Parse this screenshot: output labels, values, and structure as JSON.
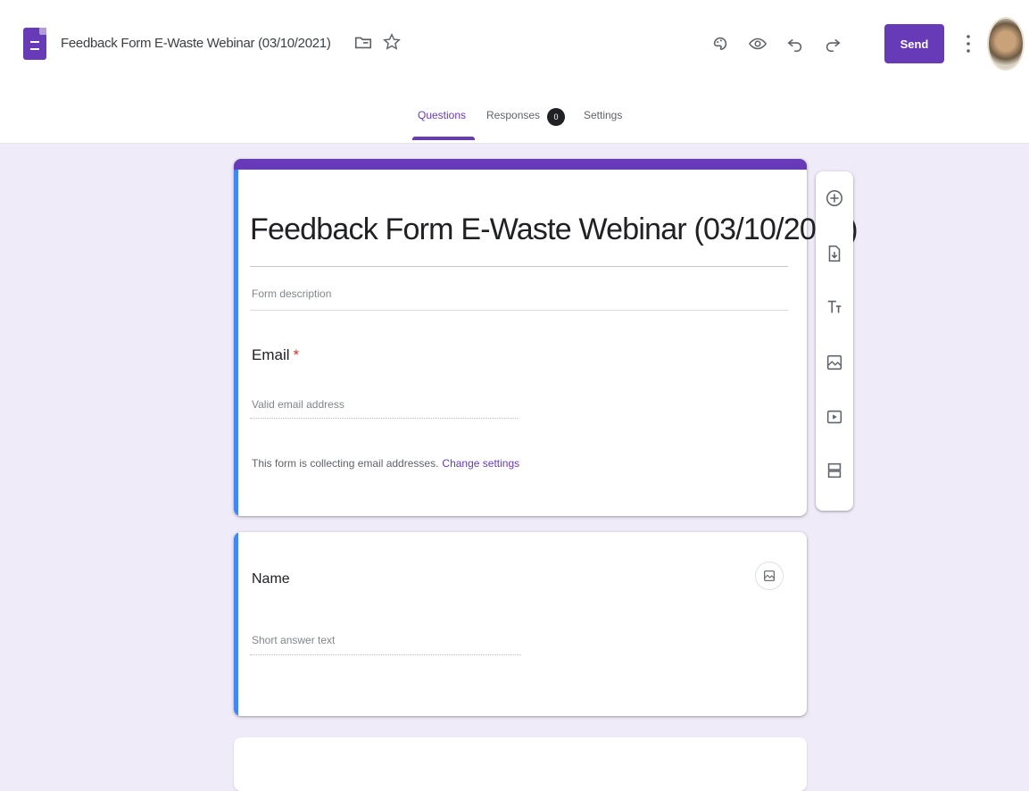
{
  "header": {
    "doc_title": "Feedback Form E-Waste Webinar (03/10/2021)",
    "send_label": "Send"
  },
  "tabs": [
    {
      "label": "Questions",
      "active": true
    },
    {
      "label": "Responses",
      "badge": "0"
    },
    {
      "label": "Settings"
    }
  ],
  "form": {
    "title": "Feedback Form E-Waste Webinar (03/10/2021)",
    "description_placeholder": "Form description",
    "email": {
      "label": "Email",
      "required_marker": "*",
      "placeholder": "Valid email address",
      "note": "This form is collecting email addresses.",
      "note_link": "Change settings"
    },
    "questions": [
      {
        "title": "Name",
        "answer_placeholder": "Short answer text"
      }
    ]
  },
  "icons": {
    "title_actions": [
      "move-to-folder-icon",
      "star-icon"
    ],
    "toolbar": [
      "customize-theme-icon",
      "preview-icon",
      "undo-icon",
      "redo-icon"
    ],
    "side_toolbar": [
      "add-question-icon",
      "import-questions-icon",
      "add-title-icon",
      "add-image-icon",
      "add-video-icon",
      "add-section-icon"
    ]
  },
  "colors": {
    "accent": "#673ab7",
    "background": "#f0ebf8",
    "active_indicator": "#4285f4"
  }
}
